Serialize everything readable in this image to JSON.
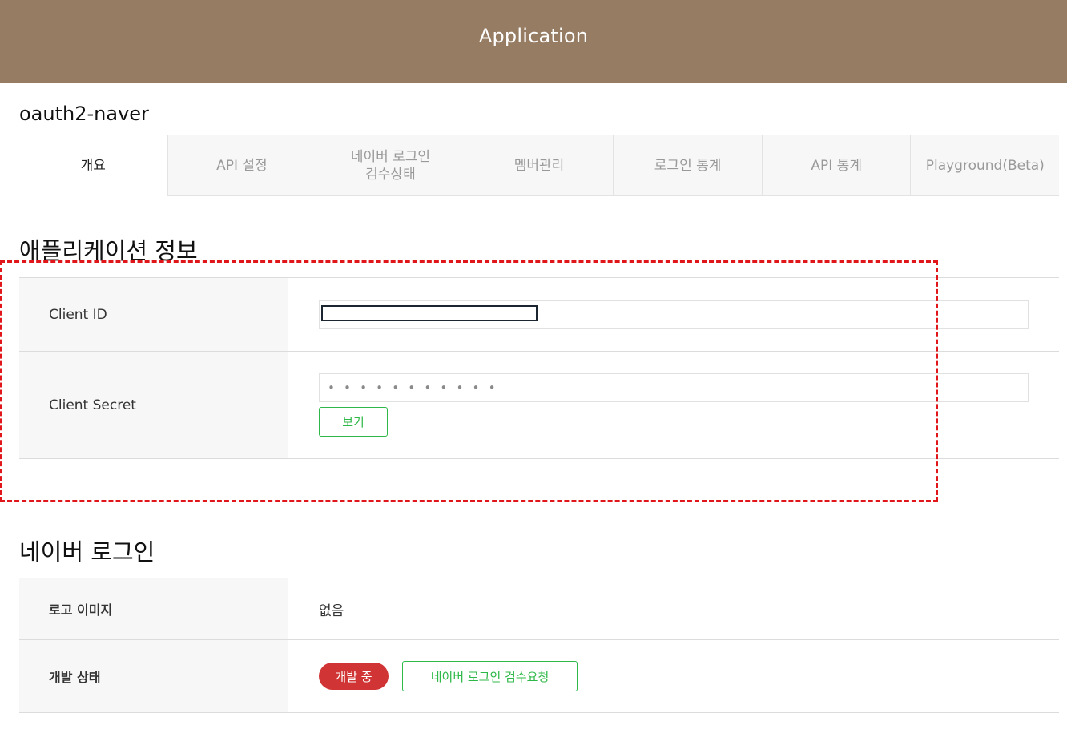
{
  "header": {
    "title": "Application"
  },
  "app": {
    "name": "oauth2-naver"
  },
  "tabs": [
    {
      "label": "개요",
      "active": true
    },
    {
      "label": "API 설정",
      "active": false
    },
    {
      "label": "네이버 로그인\n검수상태",
      "active": false
    },
    {
      "label": "멤버관리",
      "active": false
    },
    {
      "label": "로그인 통계",
      "active": false
    },
    {
      "label": "API 통계",
      "active": false
    },
    {
      "label": "Playground(Beta)",
      "active": false
    }
  ],
  "app_info": {
    "title": "애플리케이션 정보",
    "client_id_label": "Client ID",
    "client_id_value": "",
    "client_secret_label": "Client Secret",
    "client_secret_value": "• • • • • • • • • • •",
    "show_button_label": "보기"
  },
  "naver_login": {
    "title": "네이버 로그인",
    "logo_label": "로고 이미지",
    "logo_value": "없음",
    "status_label": "개발 상태",
    "status_badge": "개발 중",
    "review_button_label": "네이버 로그인 검수요청"
  },
  "colors": {
    "header_bg": "#967c63",
    "accent_green": "#2db847",
    "status_red": "#d03434",
    "highlight_red": "#e0161b"
  }
}
